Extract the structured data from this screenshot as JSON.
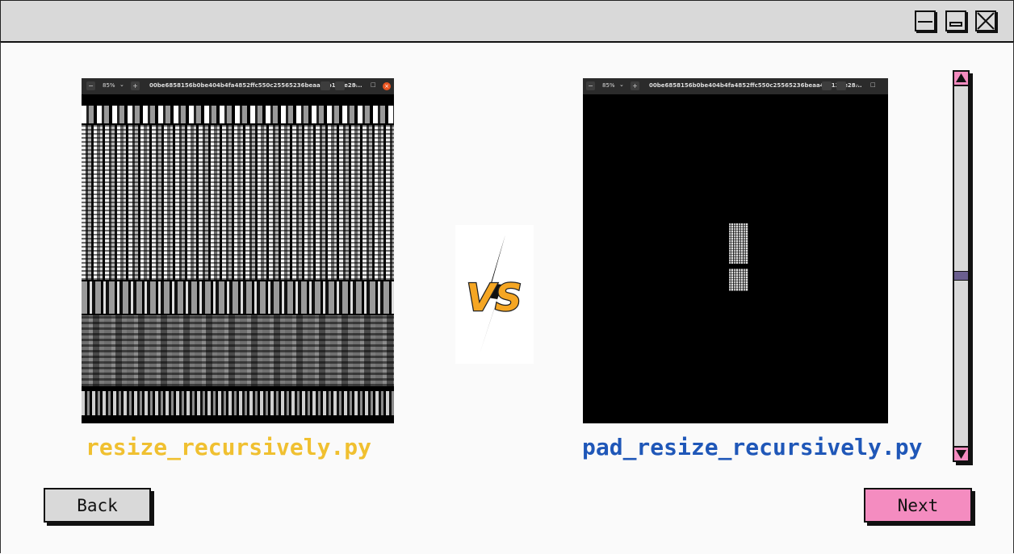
{
  "window": {
    "controls": {
      "minimize_icon": "minimize-icon",
      "maximize_icon": "maximize-icon",
      "close_icon": "close-icon"
    }
  },
  "left_screenshot": {
    "zoom": "85%",
    "filename": "00be6858156b0be404b4fa4852ffc550c25565236beaa4cb13ffe28..."
  },
  "right_screenshot": {
    "zoom": "85%",
    "filename": "00be6858156b0be404b4fa4852ffc550c25565236beaa4cb13ffe28..."
  },
  "versus": {
    "text": "VS"
  },
  "labels": {
    "left": "resize_recursively.py",
    "right": "pad_resize_recursively.py"
  },
  "buttons": {
    "back": "Back",
    "next": "Next"
  },
  "scrollbar": {
    "position": 0.5
  },
  "colors": {
    "left_label": "#f0c030",
    "right_label": "#1f57b8",
    "accent_pink": "#f48cc0",
    "titlebar": "#d9d9d9"
  }
}
